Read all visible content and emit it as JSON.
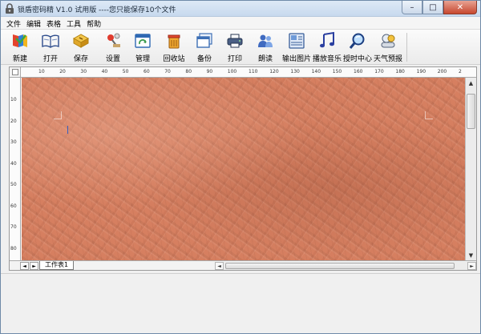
{
  "window": {
    "title": "锁盾密码精 V1.0 试用版 ----您只能保存10个文件",
    "minimize": "–",
    "maximize": "□",
    "close": "✕"
  },
  "menu": [
    "文件",
    "编辑",
    "表格",
    "工具",
    "帮助"
  ],
  "toolbar": [
    {
      "label": "新建",
      "icon": "new-icon"
    },
    {
      "label": "打开",
      "icon": "open-book-icon"
    },
    {
      "label": "保存",
      "icon": "save-icon"
    },
    {
      "label": "设置",
      "icon": "settings-pin-icon"
    },
    {
      "label": "管理",
      "icon": "manage-window-icon"
    },
    {
      "label": "回收站",
      "icon": "recycle-bin-icon"
    },
    {
      "label": "备份",
      "icon": "backup-window-icon"
    },
    {
      "label": "打印",
      "icon": "printer-icon"
    },
    {
      "label": "朗读",
      "icon": "users-read-icon"
    },
    {
      "label": "输出图片",
      "icon": "export-image-icon"
    },
    {
      "label": "播放音乐",
      "icon": "music-note-icon"
    },
    {
      "label": "授时中心",
      "icon": "magnifier-icon"
    },
    {
      "label": "天气预报",
      "icon": "weather-icon"
    }
  ],
  "ruler": {
    "horizontal": [
      "10",
      "20",
      "30",
      "40",
      "50",
      "60",
      "70",
      "80",
      "90",
      "100",
      "110",
      "120",
      "130",
      "140",
      "150",
      "160",
      "170",
      "180",
      "190",
      "200",
      "2"
    ],
    "vertical": [
      "10",
      "20",
      "30",
      "40",
      "50",
      "60",
      "70",
      "80"
    ]
  },
  "sheet": {
    "tab_label": "工作表1",
    "nav_prev": "◄",
    "nav_next": "►"
  },
  "scroll": {
    "up": "▲",
    "down": "▼",
    "left": "◄",
    "right": "►"
  },
  "colors": {
    "canvas": "#d67f60",
    "titlebar": "#c7d9ee",
    "close": "#c7472f"
  }
}
